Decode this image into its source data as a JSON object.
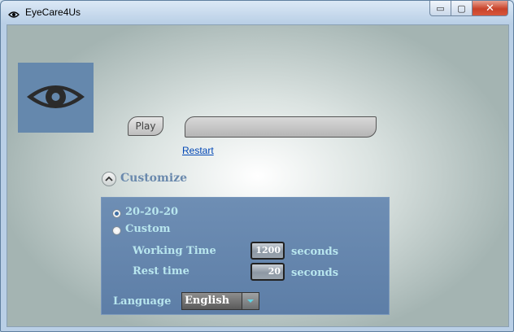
{
  "window": {
    "title": "EyeCare4Us",
    "controls": {
      "minimize": "▭",
      "maximize": "▢",
      "close": "✕"
    }
  },
  "logo": {
    "icon": "eye-icon",
    "background": "#6588ad"
  },
  "controls": {
    "play_label": "Play",
    "progress_fraction": 0.0,
    "restart_label": "Restart"
  },
  "customize": {
    "title": "Customize",
    "expanded": true,
    "mode_options": [
      {
        "label": "20-20-20",
        "selected": true
      },
      {
        "label": "Custom",
        "selected": false
      }
    ],
    "working_time": {
      "label": "Working Time",
      "value": "1200",
      "unit": "seconds"
    },
    "rest_time": {
      "label": "Rest time",
      "value": "20",
      "unit": "seconds"
    },
    "language": {
      "label": "Language",
      "value": "English"
    }
  },
  "colors": {
    "accent": "#6588ad",
    "panel": "#5f80a8",
    "label_text": "#b8e6ee",
    "link": "#0046b5",
    "close_button": "#c8432a"
  }
}
